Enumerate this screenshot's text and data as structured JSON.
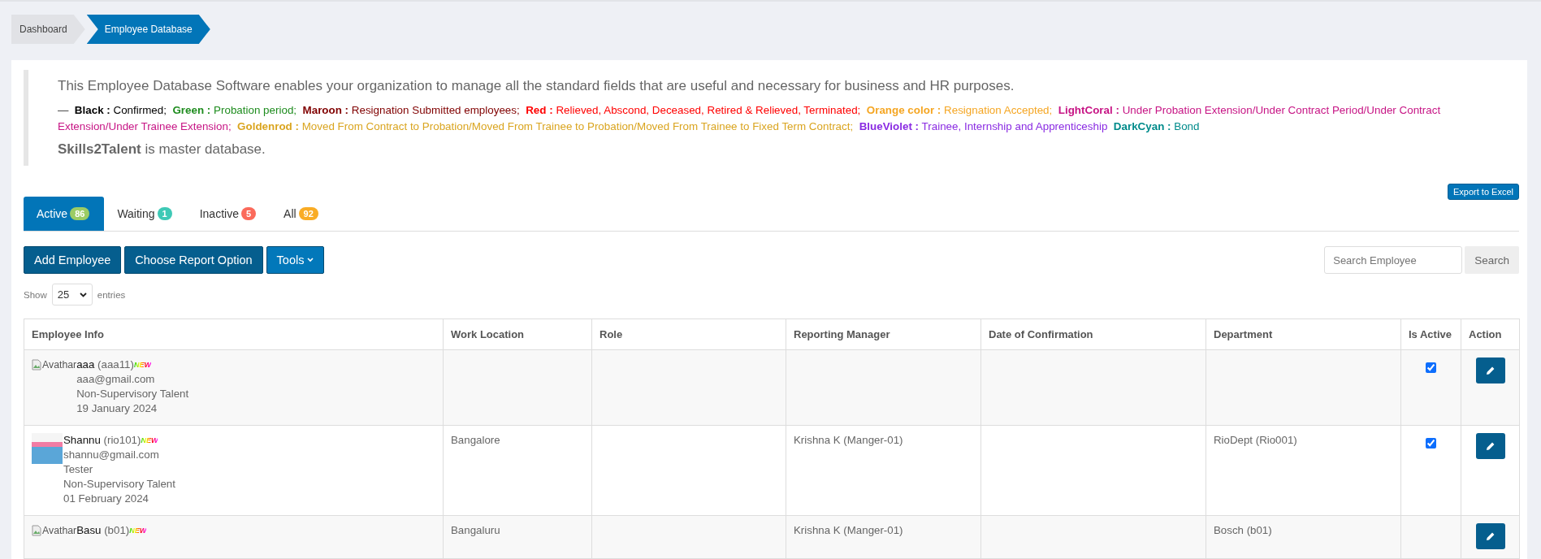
{
  "breadcrumb": [
    {
      "label": "Dashboard",
      "selected": false
    },
    {
      "label": "Employee Database",
      "selected": true
    }
  ],
  "intro": {
    "text": "This Employee Database Software enables your organization to manage all the standard fields that are useful and necessary for business and HR purposes.",
    "footer_mark": "—",
    "legend": [
      {
        "label": "Black :",
        "text": "Confirmed;",
        "color": "#000000"
      },
      {
        "label": "Green :",
        "text": "Probation period;",
        "color": "#1e8c1e"
      },
      {
        "label": "Maroon :",
        "text": "Resignation Submitted employees;",
        "color": "#800000"
      },
      {
        "label": "Red :",
        "text": "Relieved, Abscond, Deceased, Retired & Relieved, Terminated;",
        "color": "#ff0000"
      },
      {
        "label": "Orange color :",
        "text": "Resignation Accepted;",
        "color": "#f5a623"
      },
      {
        "label": "LightCoral :",
        "text": "Under Probation Extension/Under Contract Period/Under Contract Extension/Under Trainee Extension;",
        "color": "#c71585"
      },
      {
        "label": "Goldenrod :",
        "text": "Moved From Contract to Probation/Moved From Trainee to Probation/Moved From Trainee to Fixed Term Contract;",
        "color": "#daa520"
      },
      {
        "label": "BlueViolet :",
        "text": "Trainee, Internship and Apprenticeship",
        "color": "#8a2be2"
      },
      {
        "label": "DarkCyan :",
        "text": "Bond",
        "color": "#008b8b"
      }
    ],
    "master_note": "**Skills2Talent** is master database."
  },
  "export_button": "Export to Excel",
  "tabs": [
    {
      "label": "Active",
      "count": "86",
      "color": "#9ccc65",
      "selected": true
    },
    {
      "label": "Waiting",
      "count": "1",
      "color": "#3ec9b6",
      "selected": false
    },
    {
      "label": "Inactive",
      "count": "5",
      "color": "#fb6a5b",
      "selected": false
    },
    {
      "label": "All",
      "count": "92",
      "color": "#f9ac25",
      "selected": false
    }
  ],
  "actions": [
    "Add Employee",
    "Choose Report Option",
    "Tools"
  ],
  "search": {
    "placeholder": "Search Employee",
    "button": "Search"
  },
  "page_size": {
    "before": "Show",
    "value": "25",
    "after": "entries"
  },
  "table": {
    "columns": [
      "Employee Info",
      "Work Location",
      "Role",
      "Reporting Manager",
      "Date of Confirmation",
      "Department",
      "Is Active",
      "Action"
    ],
    "rows": [
      {
        "avatar": {
          "kind": "broken",
          "alt": "Avathar"
        },
        "name": "aaa",
        "code": "(aaa11)",
        "badge": "NEW",
        "details": [
          "aaa@gmail.com",
          "Non-Supervisory Talent",
          "19 January 2024"
        ],
        "work_location": "",
        "role": "",
        "manager": "",
        "confirmation": "",
        "department": "",
        "is_active": true
      },
      {
        "avatar": {
          "kind": "photo"
        },
        "name": "Shannu",
        "code": "(rio101)",
        "badge": "NEW",
        "details": [
          "shannu@gmail.com",
          "Tester",
          "Non-Supervisory Talent",
          "01 February 2024"
        ],
        "work_location": "Bangalore",
        "role": "",
        "manager": "Krishna K (Manger-01)",
        "confirmation": "",
        "department": "RioDept (Rio001)",
        "is_active": true
      },
      {
        "avatar": {
          "kind": "broken",
          "alt": "Avathar"
        },
        "name": "Basu",
        "code": "(b01)",
        "badge": "NEW",
        "details": [],
        "work_location": "Bangaluru",
        "role": "",
        "manager": "Krishna K (Manger-01)",
        "confirmation": "",
        "department": "Bosch (b01)"
      }
    ]
  }
}
